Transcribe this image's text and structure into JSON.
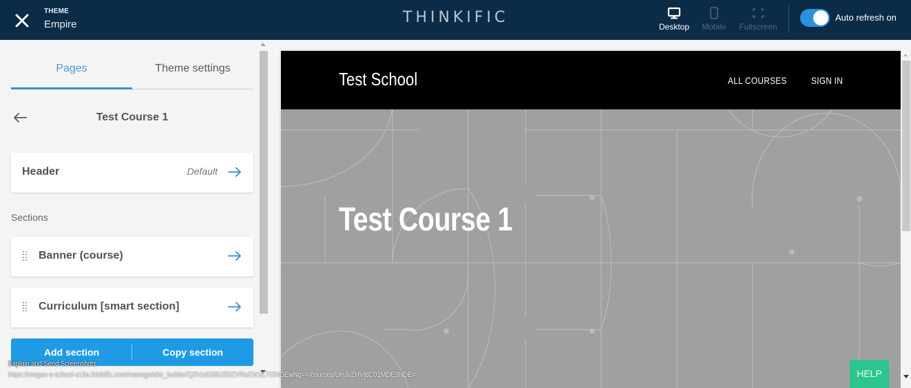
{
  "topbar": {
    "theme_label": "THEME",
    "theme_name": "Empire",
    "brand": "THINKIFIC",
    "views": [
      {
        "label": "Desktop",
        "icon": "desktop-icon",
        "active": true
      },
      {
        "label": "Mobile",
        "icon": "mobile-icon",
        "active": false
      },
      {
        "label": "Fullscreen",
        "icon": "fullscreen-icon",
        "active": false
      }
    ],
    "auto_refresh_label": "Auto refresh on",
    "auto_refresh_on": true
  },
  "panel": {
    "tabs": [
      {
        "label": "Pages",
        "active": true
      },
      {
        "label": "Theme settings",
        "active": false
      }
    ],
    "page_name": "Test Course 1",
    "header_card": {
      "label": "Header",
      "meta": "Default"
    },
    "sections_label": "Sections",
    "sections": [
      {
        "label": "Banner (course)"
      },
      {
        "label": "Curriculum [smart section]"
      }
    ],
    "add_section_label": "Add section",
    "copy_section_label": "Copy section"
  },
  "preview": {
    "site_name": "Test School",
    "nav": [
      "ALL COURSES",
      "SIGN IN"
    ],
    "hero_title": "Test Course 1"
  },
  "help_label": "HELP",
  "overlay": {
    "line1": "Explain and Send Screenshots",
    "line2": "https://megan-s-school-cc3a.thinkific.com/manage/site_builder/Q3VzdG9tU2l0ZVRoZW1lLTI2NDEwNg==/courses/UHJvZHVjdC01MDE3NDE="
  },
  "colors": {
    "topbar_bg": "#0c2b47",
    "accent_blue": "#1f9be6",
    "tab_active": "#4a9ccd",
    "help_green": "#2dc48d",
    "hero_bg": "#a0a0a0"
  }
}
